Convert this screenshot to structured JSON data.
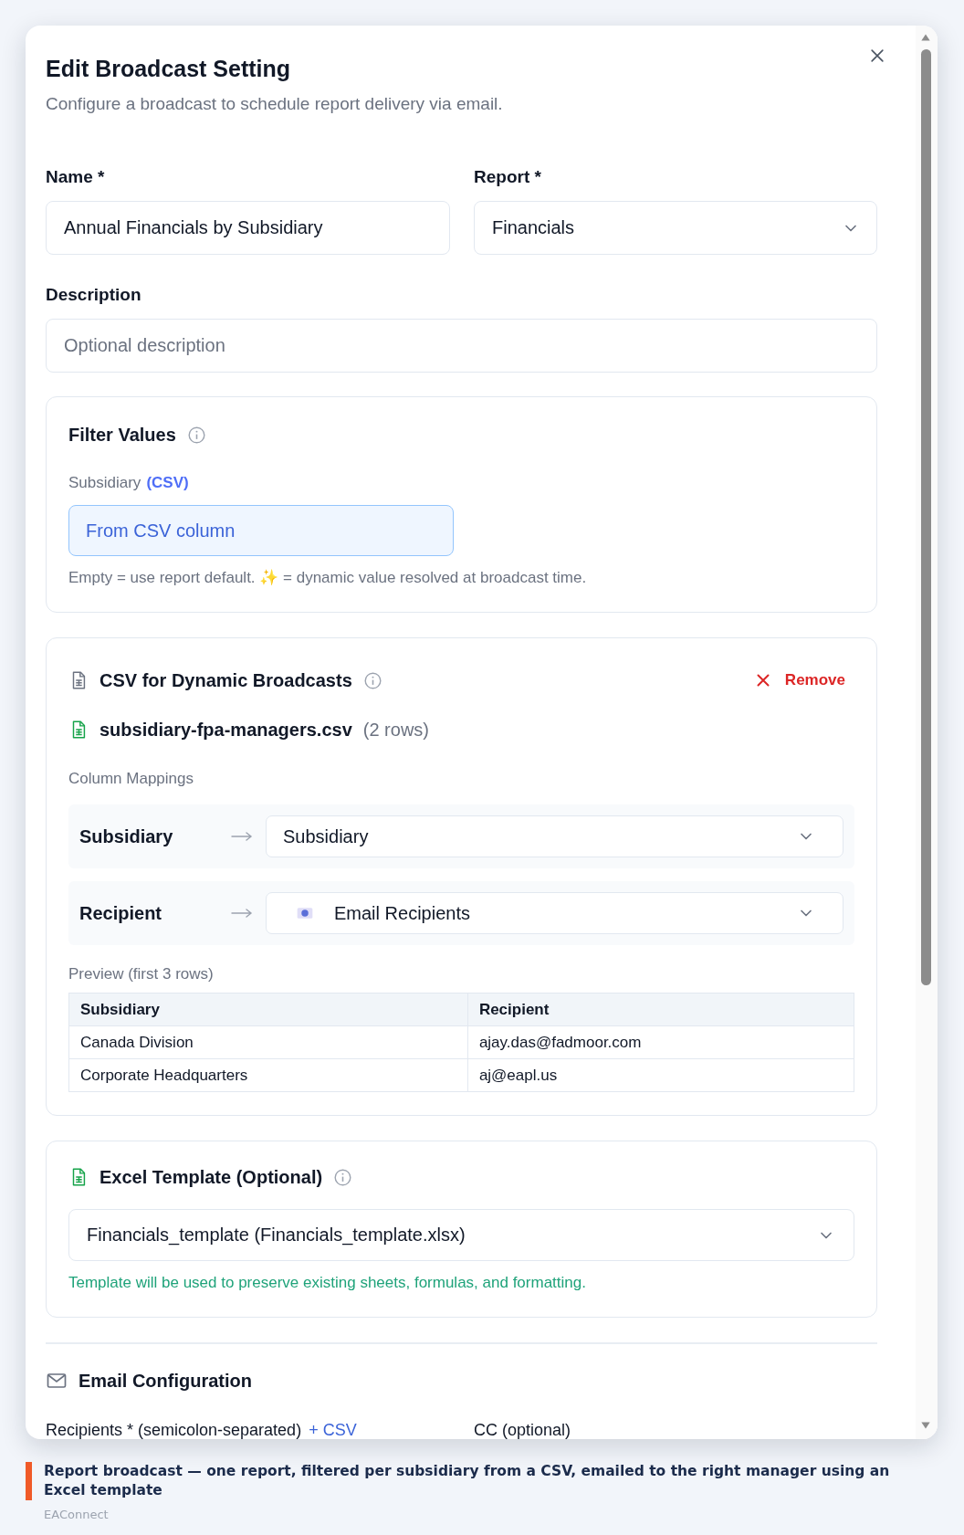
{
  "dialog": {
    "title": "Edit Broadcast Setting",
    "subtitle": "Configure a broadcast to schedule report delivery via email."
  },
  "fields": [
    {
      "kind": "text",
      "label": "Name *",
      "value": "Annual Financials by Subsidiary"
    },
    {
      "kind": "select",
      "label": "Report *",
      "value": "Financials"
    }
  ],
  "description": {
    "kind": "text",
    "label": "Description",
    "placeholder": "Optional description"
  },
  "filter_values": {
    "title": "Filter Values",
    "field_label": "Subsidiary",
    "field_tag": "(CSV)",
    "field_value": "From CSV column",
    "help": "Empty = use report default. ✨ = dynamic value resolved at broadcast time."
  },
  "csv": {
    "title": "CSV for Dynamic Broadcasts",
    "remove_label": "Remove",
    "file_name": "subsidiary-fpa-managers.csv",
    "row_count": "(2 rows)",
    "mappings_label": "Column Mappings",
    "mappings": [
      {
        "kind": "plain",
        "source": "Subsidiary",
        "target": "Subsidiary"
      },
      {
        "kind": "recipients",
        "source": "Recipient",
        "target": "Email Recipients"
      }
    ],
    "preview_label": "Preview (first 3 rows)",
    "preview": {
      "columns": [
        "Subsidiary",
        "Recipient"
      ],
      "rows": [
        [
          "Canada Division",
          "ajay.das@fadmoor.com"
        ],
        [
          "Corporate Headquarters",
          "aj@eapl.us"
        ]
      ]
    }
  },
  "excel_template": {
    "title": "Excel Template (Optional)",
    "value": "Financials_template (Financials_template.xlsx)",
    "help": "Template will be used to preserve existing sheets, formulas, and formatting."
  },
  "email_config": {
    "title": "Email Configuration",
    "fields": [
      {
        "label": "Recipients * (semicolon-separated)",
        "link": "+ CSV"
      },
      {
        "label": "CC (optional)"
      }
    ]
  },
  "caption": {
    "text": "Report broadcast — one report, filtered per subsidiary from a CSV, emailed to the right manager using an Excel template",
    "source": "EAConnect"
  }
}
